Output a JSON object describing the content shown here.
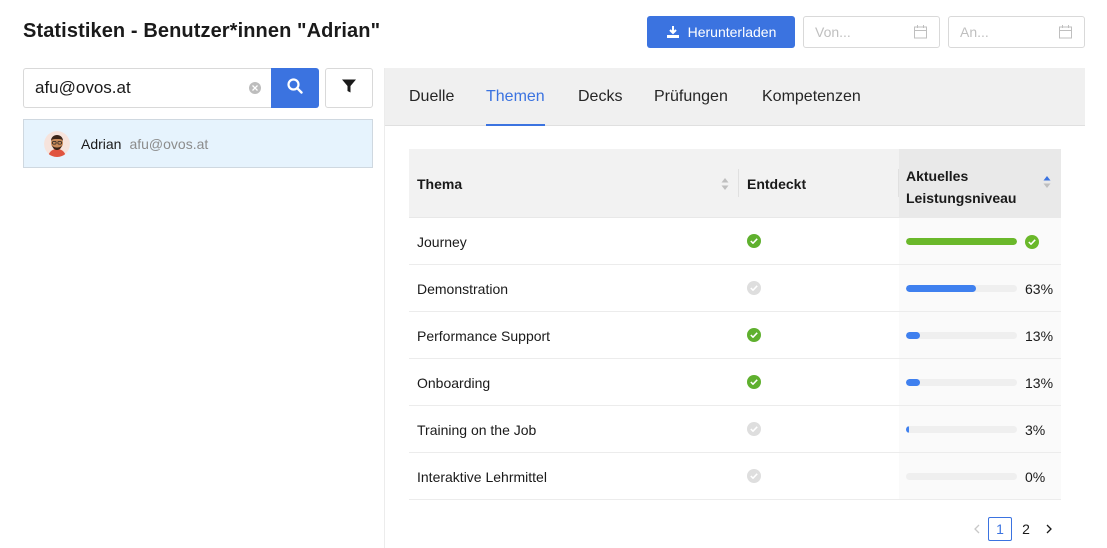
{
  "header": {
    "title": "Statistiken - Benutzer*innen \"Adrian\"",
    "download_label": "Herunterladen",
    "date_from_placeholder": "Von...",
    "date_to_placeholder": "An..."
  },
  "search": {
    "value": "afu@ovos.at"
  },
  "user": {
    "name": "Adrian",
    "email": "afu@ovos.at"
  },
  "tabs": [
    {
      "label": "Duelle",
      "active": false
    },
    {
      "label": "Themen",
      "active": true
    },
    {
      "label": "Decks",
      "active": false
    },
    {
      "label": "Prüfungen",
      "active": false
    },
    {
      "label": "Kompetenzen",
      "active": false
    }
  ],
  "table": {
    "columns": {
      "topic": "Thema",
      "discovered": "Entdeckt",
      "level_line1": "Aktuelles",
      "level_line2": "Leistungsniveau"
    },
    "rows": [
      {
        "topic": "Journey",
        "discovered": true,
        "level": 100,
        "level_text": "",
        "complete": true
      },
      {
        "topic": "Demonstration",
        "discovered": false,
        "level": 63,
        "level_text": "63%",
        "complete": false
      },
      {
        "topic": "Performance Support",
        "discovered": true,
        "level": 13,
        "level_text": "13%",
        "complete": false
      },
      {
        "topic": "Onboarding",
        "discovered": true,
        "level": 13,
        "level_text": "13%",
        "complete": false
      },
      {
        "topic": "Training on the Job",
        "discovered": false,
        "level": 3,
        "level_text": "3%",
        "complete": false
      },
      {
        "topic": "Interaktive Lehrmittel",
        "discovered": false,
        "level": 0,
        "level_text": "0%",
        "complete": false
      }
    ]
  },
  "pagination": {
    "pages": [
      "1",
      "2"
    ],
    "current": "1"
  },
  "colors": {
    "accent": "#3b73e0",
    "progress": "#3f80ef",
    "success": "#6ab82a",
    "selected_row": "#e6f3fd"
  }
}
